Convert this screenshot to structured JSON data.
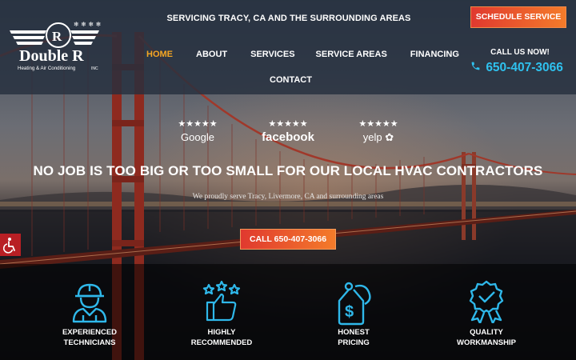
{
  "header": {
    "logo_text": "Double R",
    "logo_subtext": "Heating & Air Conditioning",
    "logo_inc": "INC",
    "servicing": "SERVICING TRACY, CA AND THE SURROUNDING AREAS",
    "schedule_label": "SCHEDULE SERVICE",
    "call_label": "CALL US NOW!",
    "phone": "650-407-3066"
  },
  "nav": {
    "items": [
      {
        "label": "HOME",
        "active": true
      },
      {
        "label": "ABOUT"
      },
      {
        "label": "SERVICES"
      },
      {
        "label": "SERVICE AREAS"
      },
      {
        "label": "FINANCING"
      },
      {
        "label": "CONTACT"
      }
    ]
  },
  "reviews": [
    {
      "stars": "★★★★★",
      "name": "Google"
    },
    {
      "stars": "★★★★★",
      "name": "facebook"
    },
    {
      "stars": "★★★★★",
      "name": "yelp"
    }
  ],
  "hero": {
    "headline": "NO JOB IS TOO BIG OR TOO SMALL FOR OUR LOCAL HVAC CONTRACTORS",
    "subline": "We proudly serve Tracy, Livermore, CA and surrounding areas",
    "call_button": "CALL 650-407-3066"
  },
  "features": [
    {
      "line1": "EXPERIENCED",
      "line2": "TECHNICIANS",
      "icon": "technician-icon"
    },
    {
      "line1": "HIGHLY",
      "line2": "RECOMMENDED",
      "icon": "thumbs-up-icon"
    },
    {
      "line1": "HONEST",
      "line2": "PRICING",
      "icon": "price-tag-icon"
    },
    {
      "line1": "QUALITY",
      "line2": "WORKMANSHIP",
      "icon": "quality-badge-icon"
    }
  ],
  "colors": {
    "accent_orange": "#f5a623",
    "button_red": "#e0392f",
    "button_orange": "#f47b2a",
    "phone_blue": "#2fc1ee",
    "icon_blue": "#2fb8ea",
    "accessibility_red": "#b81f24"
  }
}
